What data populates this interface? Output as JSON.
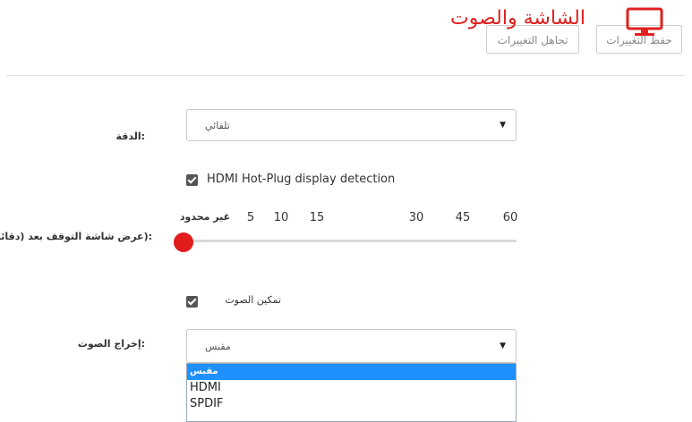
{
  "header": {
    "title": "الشاشة والصوت",
    "save_label": "حفظ التغييرات",
    "discard_label": "تجاهل التغييرات",
    "icon": "monitor-icon",
    "accent_color": "#e02020"
  },
  "resolution": {
    "label": ":الدقة",
    "value": "تلقائي"
  },
  "hdmi_detection": {
    "label": "HDMI Hot-Plug display detection",
    "checked": true
  },
  "screensaver": {
    "label": ":(عرض شاشة التوقف بعد (دقائق",
    "ticks": [
      "غير محدود",
      "5",
      "10",
      "15",
      "30",
      "45",
      "60"
    ],
    "selected": "غير محدود",
    "thumb_color": "#e21b1b"
  },
  "audio_enable": {
    "label": "تمكين الصوت",
    "checked": true
  },
  "audio_output": {
    "label": ":إخراج الصوت",
    "value": "مقبس",
    "options": [
      "مقبس",
      "HDMI",
      "SPDIF"
    ],
    "highlight_color": "#1e90ff"
  }
}
